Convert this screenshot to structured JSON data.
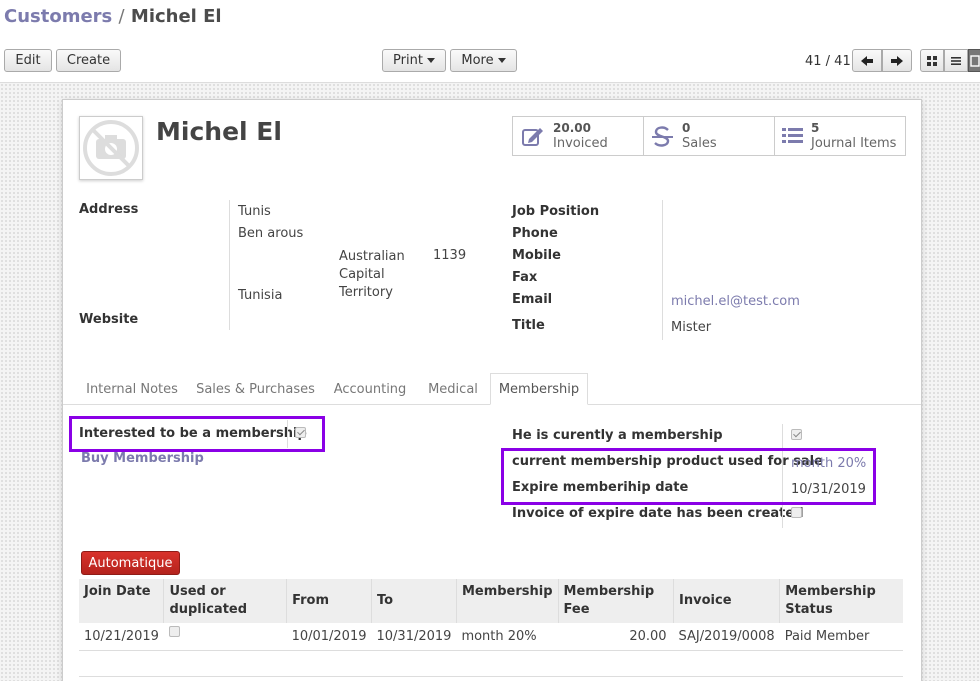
{
  "breadcrumb": {
    "parent": "Customers",
    "separator": "/",
    "current": "Michel El"
  },
  "toolbar": {
    "edit": "Edit",
    "create": "Create",
    "print": "Print",
    "more": "More"
  },
  "pager": {
    "value": "41 / 41"
  },
  "record": {
    "name": "Michel El"
  },
  "stats": [
    {
      "value": "20.00",
      "label": "Invoiced",
      "icon": "pencil-square-icon"
    },
    {
      "value": "0",
      "label": "Sales",
      "icon": "strikethrough-s-icon"
    },
    {
      "value": "5",
      "label": "Journal Items",
      "icon": "list-icon"
    }
  ],
  "address": {
    "label": "Address",
    "street": "Tunis",
    "street2": "Ben arous",
    "state": "Australian Capital Territory",
    "zip": "1139",
    "country": "Tunisia",
    "website_label": "Website"
  },
  "contact": {
    "job_label": "Job Position",
    "phone_label": "Phone",
    "mobile_label": "Mobile",
    "fax_label": "Fax",
    "email_label": "Email",
    "email": "michel.el@test.com",
    "title_label": "Title",
    "title": "Mister"
  },
  "tabs": [
    "Internal Notes",
    "Sales & Purchases",
    "Accounting",
    "Medical",
    "Membership"
  ],
  "membership": {
    "interested_label": "Interested to be a membership",
    "buy_link": "Buy Membership",
    "current_label": "He is curently a membership",
    "product_label": "current membership product used for sale",
    "product_value": "month 20%",
    "expire_label": "Expire memberihip date",
    "expire_value": "10/31/2019",
    "invoice_label": "Invoice of expire date has been created",
    "auto_button": "Automatique"
  },
  "lines": {
    "headers": [
      "Join Date",
      "Used or duplicated",
      "From",
      "To",
      "Membership",
      "Membership Fee",
      "Invoice",
      "Membership Status"
    ],
    "rows": [
      {
        "join": "10/21/2019",
        "from": "10/01/2019",
        "to": "10/31/2019",
        "membership": "month 20%",
        "fee": "20.00",
        "invoice": "SAJ/2019/0008",
        "status": "Paid Member"
      }
    ]
  },
  "colors": {
    "accent": "#7c7bad",
    "highlight": "#8a00e6",
    "danger": "#c9302c"
  }
}
